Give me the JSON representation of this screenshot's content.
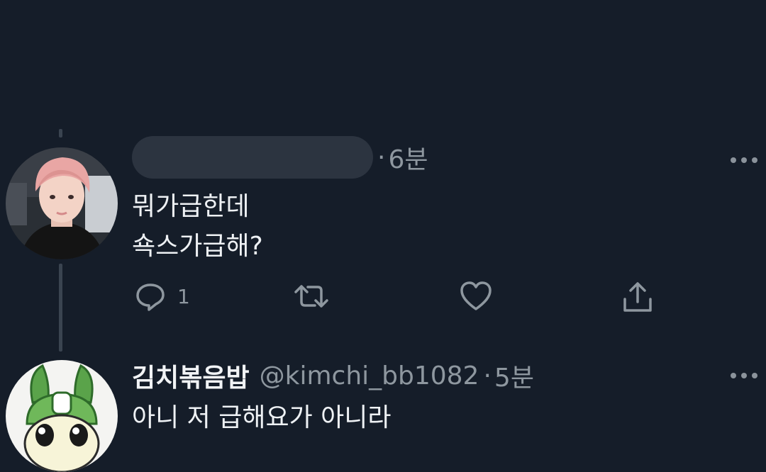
{
  "tweet1": {
    "time": "6분",
    "lines": [
      "뭐가급한데",
      "쇽스가급해?"
    ],
    "reply_count": "1",
    "icons": {
      "reply": "reply-icon",
      "retweet": "retweet-icon",
      "like": "heart-icon",
      "share": "share-icon",
      "more": "more-icon"
    }
  },
  "tweet2": {
    "display_name": "김치볶음밥",
    "handle": "@kimchi_bb1082",
    "time": "5분",
    "line1": "아니 저 급해요가 아니라"
  },
  "colors": {
    "background": "#151d29",
    "text": "#e9edf1",
    "muted": "#8e979f",
    "thread_line": "#3a4450"
  }
}
